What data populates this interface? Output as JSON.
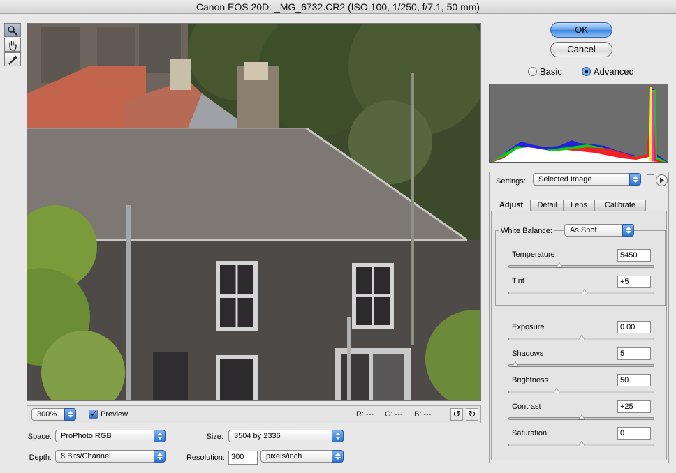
{
  "window": {
    "title": "Canon EOS 20D:  _MG_6732.CR2  (ISO 100, 1/250, f/7.1, 50 mm)"
  },
  "tools": [
    {
      "icon": "zoom-icon"
    },
    {
      "icon": "hand-icon"
    },
    {
      "icon": "white-balance-eyedropper-icon"
    }
  ],
  "preview_bar": {
    "zoom": "300%",
    "preview_label": "Preview",
    "preview_checked": true,
    "r_readout": "R:  ---",
    "g_readout": "G:  ---",
    "b_readout": "B:  ---"
  },
  "output_options": {
    "space_label": "Space:",
    "space_value": "ProPhoto RGB",
    "depth_label": "Depth:",
    "depth_value": "8 Bits/Channel",
    "size_label": "Size:",
    "size_value": "3504 by 2336",
    "resolution_label": "Resolution:",
    "resolution_value": "300",
    "resolution_unit": "pixels/inch"
  },
  "buttons": {
    "ok": "OK",
    "cancel": "Cancel"
  },
  "mode": {
    "basic": "Basic",
    "advanced": "Advanced",
    "selected": "Advanced"
  },
  "settings": {
    "label": "Settings:",
    "value": "Selected Image"
  },
  "tabs": [
    {
      "label": "Adjust",
      "active": true
    },
    {
      "label": "Detail",
      "active": false
    },
    {
      "label": "Lens",
      "active": false
    },
    {
      "label": "Calibrate",
      "active": false
    }
  ],
  "white_balance": {
    "label": "White Balance:",
    "value": "As Shot",
    "temperature": {
      "label": "Temperature",
      "value": "5450",
      "level": 0.35
    },
    "tint": {
      "label": "Tint",
      "value": "+5",
      "level": 0.52
    }
  },
  "adjustments": {
    "exposure": {
      "label": "Exposure",
      "value": "0.00",
      "level": 0.5
    },
    "shadows": {
      "label": "Shadows",
      "value": "5",
      "level": 0.05
    },
    "brightness": {
      "label": "Brightness",
      "value": "50",
      "level": 0.33
    },
    "contrast": {
      "label": "Contrast",
      "value": "+25",
      "level": 0.5
    },
    "saturation": {
      "label": "Saturation",
      "value": "0",
      "level": 0.5
    }
  },
  "colors": {
    "accent_blue": "#3c86e0",
    "histogram_bg": "#6d6d6d"
  }
}
